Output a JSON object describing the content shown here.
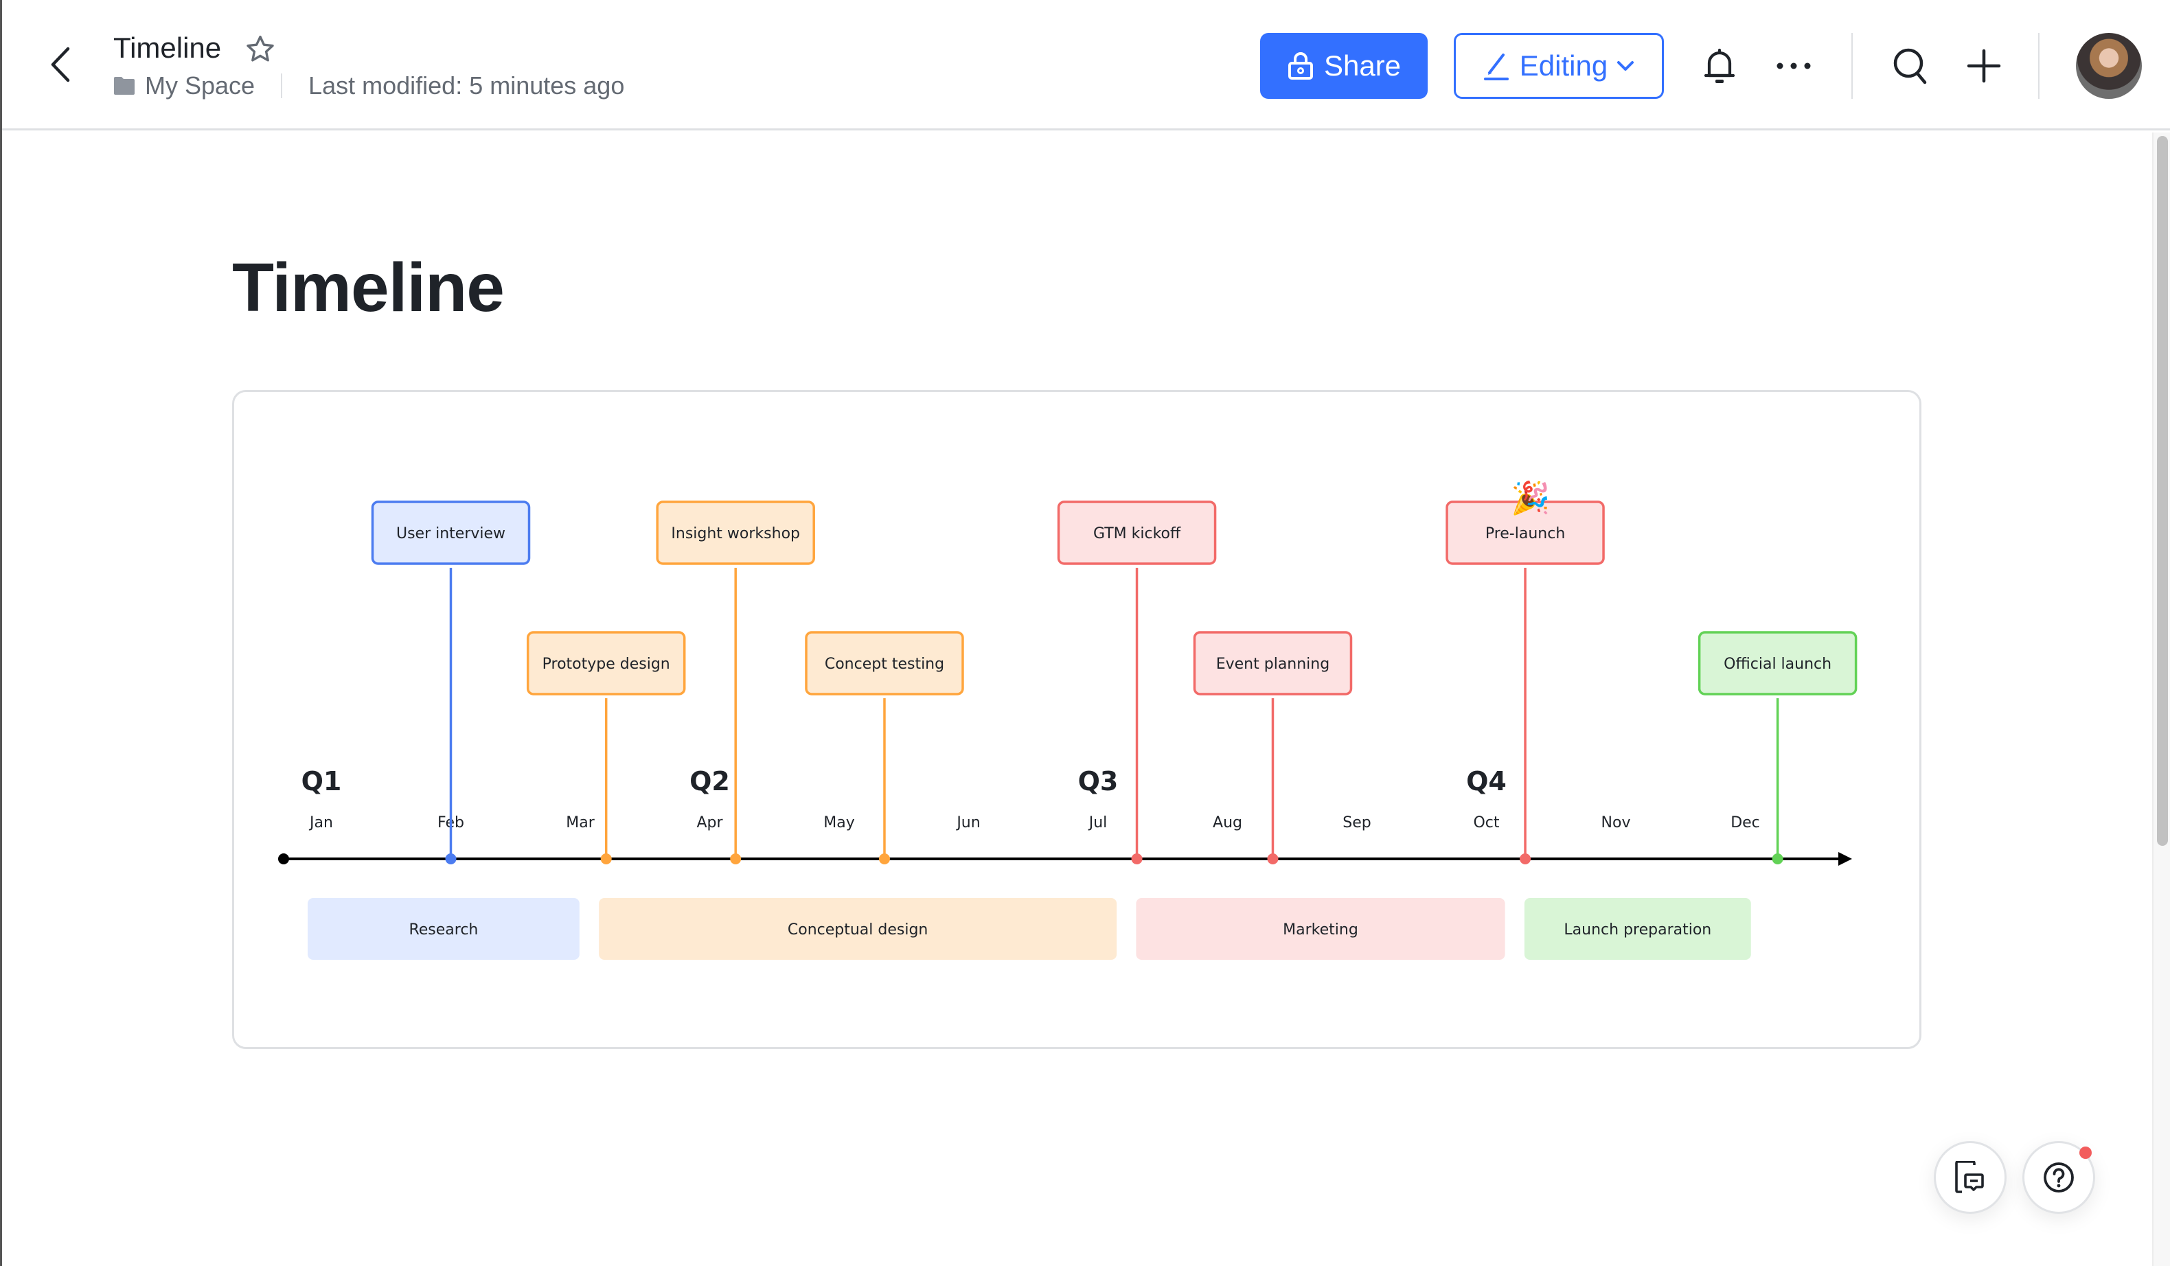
{
  "header": {
    "doc_title": "Timeline",
    "location": "My Space",
    "last_modified": "Last modified: 5 minutes ago",
    "share_label": "Share",
    "editing_label": "Editing"
  },
  "page": {
    "title": "Timeline"
  },
  "colors": {
    "accent": "#3370ff",
    "blue": "#4c7cf0",
    "blue_fill": "#e1eaff",
    "orange": "#ffa53d",
    "orange_fill": "#feead2",
    "red": "#f26a68",
    "red_fill": "#fde2e2",
    "green": "#62d256",
    "green_fill": "#d9f5d6",
    "axis": "#000000",
    "notification_dot": "#f25c5c"
  },
  "timeline": {
    "quarters": [
      {
        "label": "Q1",
        "month_index": 0
      },
      {
        "label": "Q2",
        "month_index": 3
      },
      {
        "label": "Q3",
        "month_index": 6
      },
      {
        "label": "Q4",
        "month_index": 9
      }
    ],
    "months": [
      "Jan",
      "Feb",
      "Mar",
      "Apr",
      "May",
      "Jun",
      "Jul",
      "Aug",
      "Sep",
      "Oct",
      "Nov",
      "Dec"
    ],
    "milestones": [
      {
        "label": "User interview",
        "month_pos": 1.0,
        "row": "top",
        "color": "blue"
      },
      {
        "label": "Prototype design",
        "month_pos": 2.2,
        "row": "bottom",
        "color": "orange"
      },
      {
        "label": "Insight workshop",
        "month_pos": 3.2,
        "row": "top",
        "color": "orange"
      },
      {
        "label": "Concept testing",
        "month_pos": 4.35,
        "row": "bottom",
        "color": "orange"
      },
      {
        "label": "GTM kickoff",
        "month_pos": 6.3,
        "row": "top",
        "color": "red"
      },
      {
        "label": "Event planning",
        "month_pos": 7.35,
        "row": "bottom",
        "color": "red"
      },
      {
        "label": "Pre-launch",
        "month_pos": 9.3,
        "row": "top",
        "color": "red",
        "emoji": "🎉"
      },
      {
        "label": "Official launch",
        "month_pos": 11.25,
        "row": "bottom",
        "color": "green"
      }
    ],
    "phases": [
      {
        "label": "Research",
        "start": 0.0,
        "end": 2.1,
        "color": "blue"
      },
      {
        "label": "Conceptual design",
        "start": 2.25,
        "end": 6.25,
        "color": "orange"
      },
      {
        "label": "Marketing",
        "start": 6.4,
        "end": 9.25,
        "color": "red"
      },
      {
        "label": "Launch preparation",
        "start": 9.4,
        "end": 11.15,
        "color": "green"
      }
    ]
  },
  "icons": {
    "back": "chevron-left-icon",
    "star": "star-icon",
    "folder": "folder-icon",
    "share": "lock-icon",
    "edit": "pencil-icon",
    "dropdown": "chevron-down-icon",
    "notifications": "bell-icon",
    "more": "ellipsis-icon",
    "search": "search-icon",
    "add": "plus-icon",
    "comments_panel": "document-comment-icon",
    "help": "question-circle-icon"
  }
}
